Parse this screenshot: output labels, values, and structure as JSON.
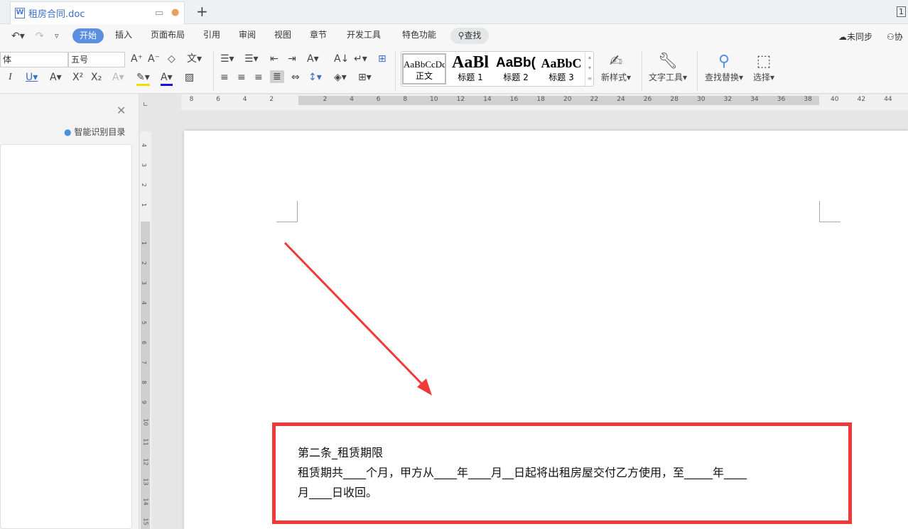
{
  "tabbar": {
    "doc_title": "租房合同.doc",
    "new_tab": "+",
    "page_indicator": "1"
  },
  "menu": {
    "tabs": [
      "开始",
      "插入",
      "页面布局",
      "引用",
      "审阅",
      "视图",
      "章节",
      "开发工具",
      "特色功能"
    ],
    "search": "查找",
    "sync": "未同步",
    "collab": "协"
  },
  "toolbar": {
    "font_name": "体",
    "font_size": "五号",
    "styles": [
      {
        "preview": "AaBbCcDd",
        "label": "正文"
      },
      {
        "preview": "AaBl",
        "label": "标题 1"
      },
      {
        "preview": "AaBb(",
        "label": "标题 2"
      },
      {
        "preview": "AaBbC",
        "label": "标题 3"
      }
    ],
    "new_style": "新样式",
    "text_tools": "文字工具",
    "find_replace": "查找替换",
    "select": "选择"
  },
  "left_panel": {
    "smart_toc": "智能识别目录"
  },
  "ruler": {
    "h_ticks": [
      "8",
      "6",
      "4",
      "2",
      "2",
      "4",
      "6",
      "8",
      "10",
      "12",
      "14",
      "16",
      "18",
      "20",
      "22",
      "24",
      "26",
      "28",
      "30",
      "32",
      "34",
      "36",
      "38",
      "40",
      "42",
      "44"
    ],
    "v_ticks": [
      "4",
      "3",
      "2",
      "1",
      "1",
      "2",
      "3",
      "4",
      "5",
      "6",
      "7",
      "8",
      "9",
      "10",
      "11",
      "12",
      "13",
      "14",
      "15"
    ]
  },
  "document": {
    "heading": "第二条_租赁期限",
    "line1": "租赁期共____个月，甲方从____年____月__日起将出租房屋交付乙方使用，至_____年____",
    "line2": "月____日收回。"
  },
  "colors": {
    "accent": "#5b8fe0",
    "annotation": "#f03a3a"
  }
}
